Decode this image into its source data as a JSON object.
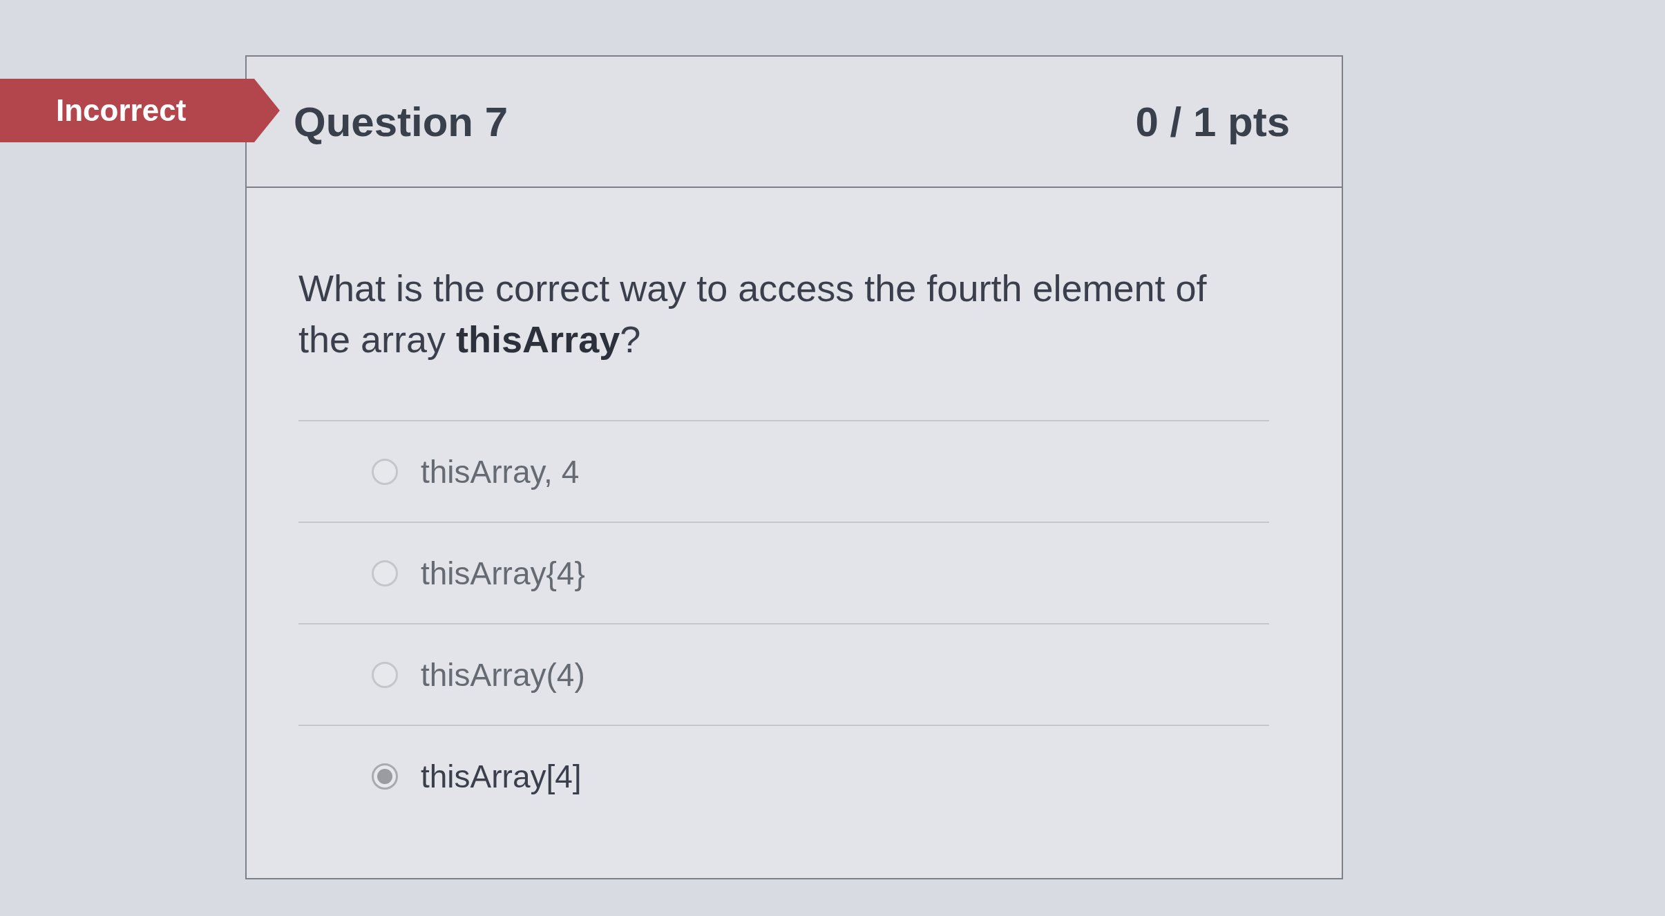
{
  "result": {
    "label": "Incorrect",
    "correct": false
  },
  "question": {
    "title": "Question 7",
    "points": "0 / 1 pts",
    "text": "What is the correct way to access the fourth element of the array **thisArray**?"
  },
  "answers": [
    {
      "label": "thisArray, 4",
      "selected": false
    },
    {
      "label": "thisArray{4}",
      "selected": false
    },
    {
      "label": "thisArray(4)",
      "selected": false
    },
    {
      "label": "thisArray[4]",
      "selected": true
    }
  ]
}
